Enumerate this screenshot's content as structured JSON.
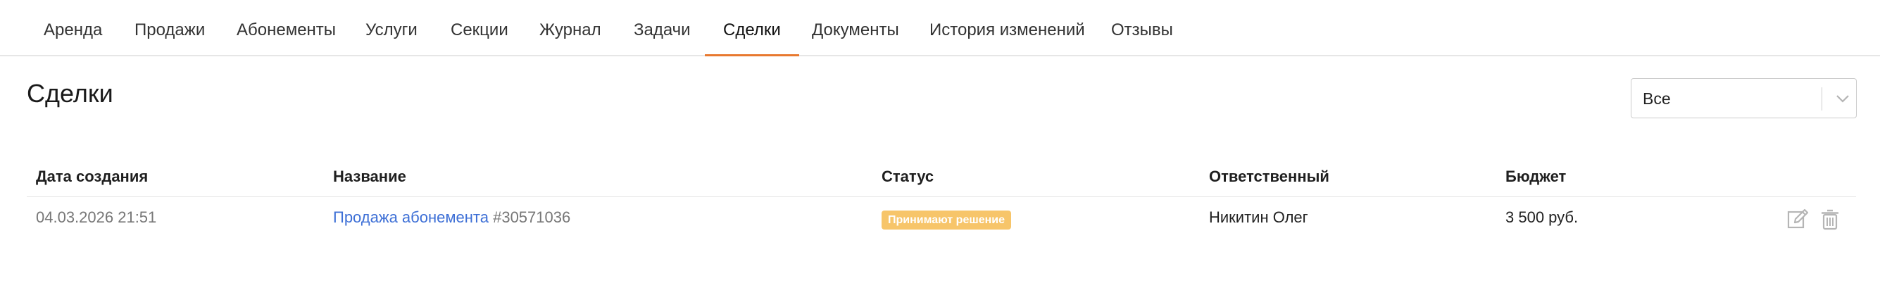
{
  "tabs": [
    {
      "label": "Аренда"
    },
    {
      "label": "Продажи"
    },
    {
      "label": "Абонементы"
    },
    {
      "label": "Услуги"
    },
    {
      "label": "Секции"
    },
    {
      "label": "Журнал"
    },
    {
      "label": "Задачи"
    },
    {
      "label": "Сделки",
      "active": true
    },
    {
      "label": "Документы"
    },
    {
      "label": "История изменений"
    },
    {
      "label": "Отзывы"
    }
  ],
  "page": {
    "title": "Сделки",
    "filter": {
      "selected": "Все"
    }
  },
  "table": {
    "columns": [
      "Дата создания",
      "Название",
      "Статус",
      "Ответственный",
      "Бюджет"
    ],
    "rows": [
      {
        "date": "04.03.2026 21:51",
        "name": "Продажа абонемента",
        "id": "#30571036",
        "status": "Принимают решение",
        "responsible": "Никитин Олег",
        "budget": "3 500 руб."
      }
    ]
  },
  "icons": {
    "edit": "edit-icon",
    "delete": "trash-icon",
    "dropdown": "chevron-down-icon"
  },
  "colors": {
    "accent": "#e8792f",
    "link": "#3d6fd6",
    "status_badge": "#f7c56a"
  }
}
